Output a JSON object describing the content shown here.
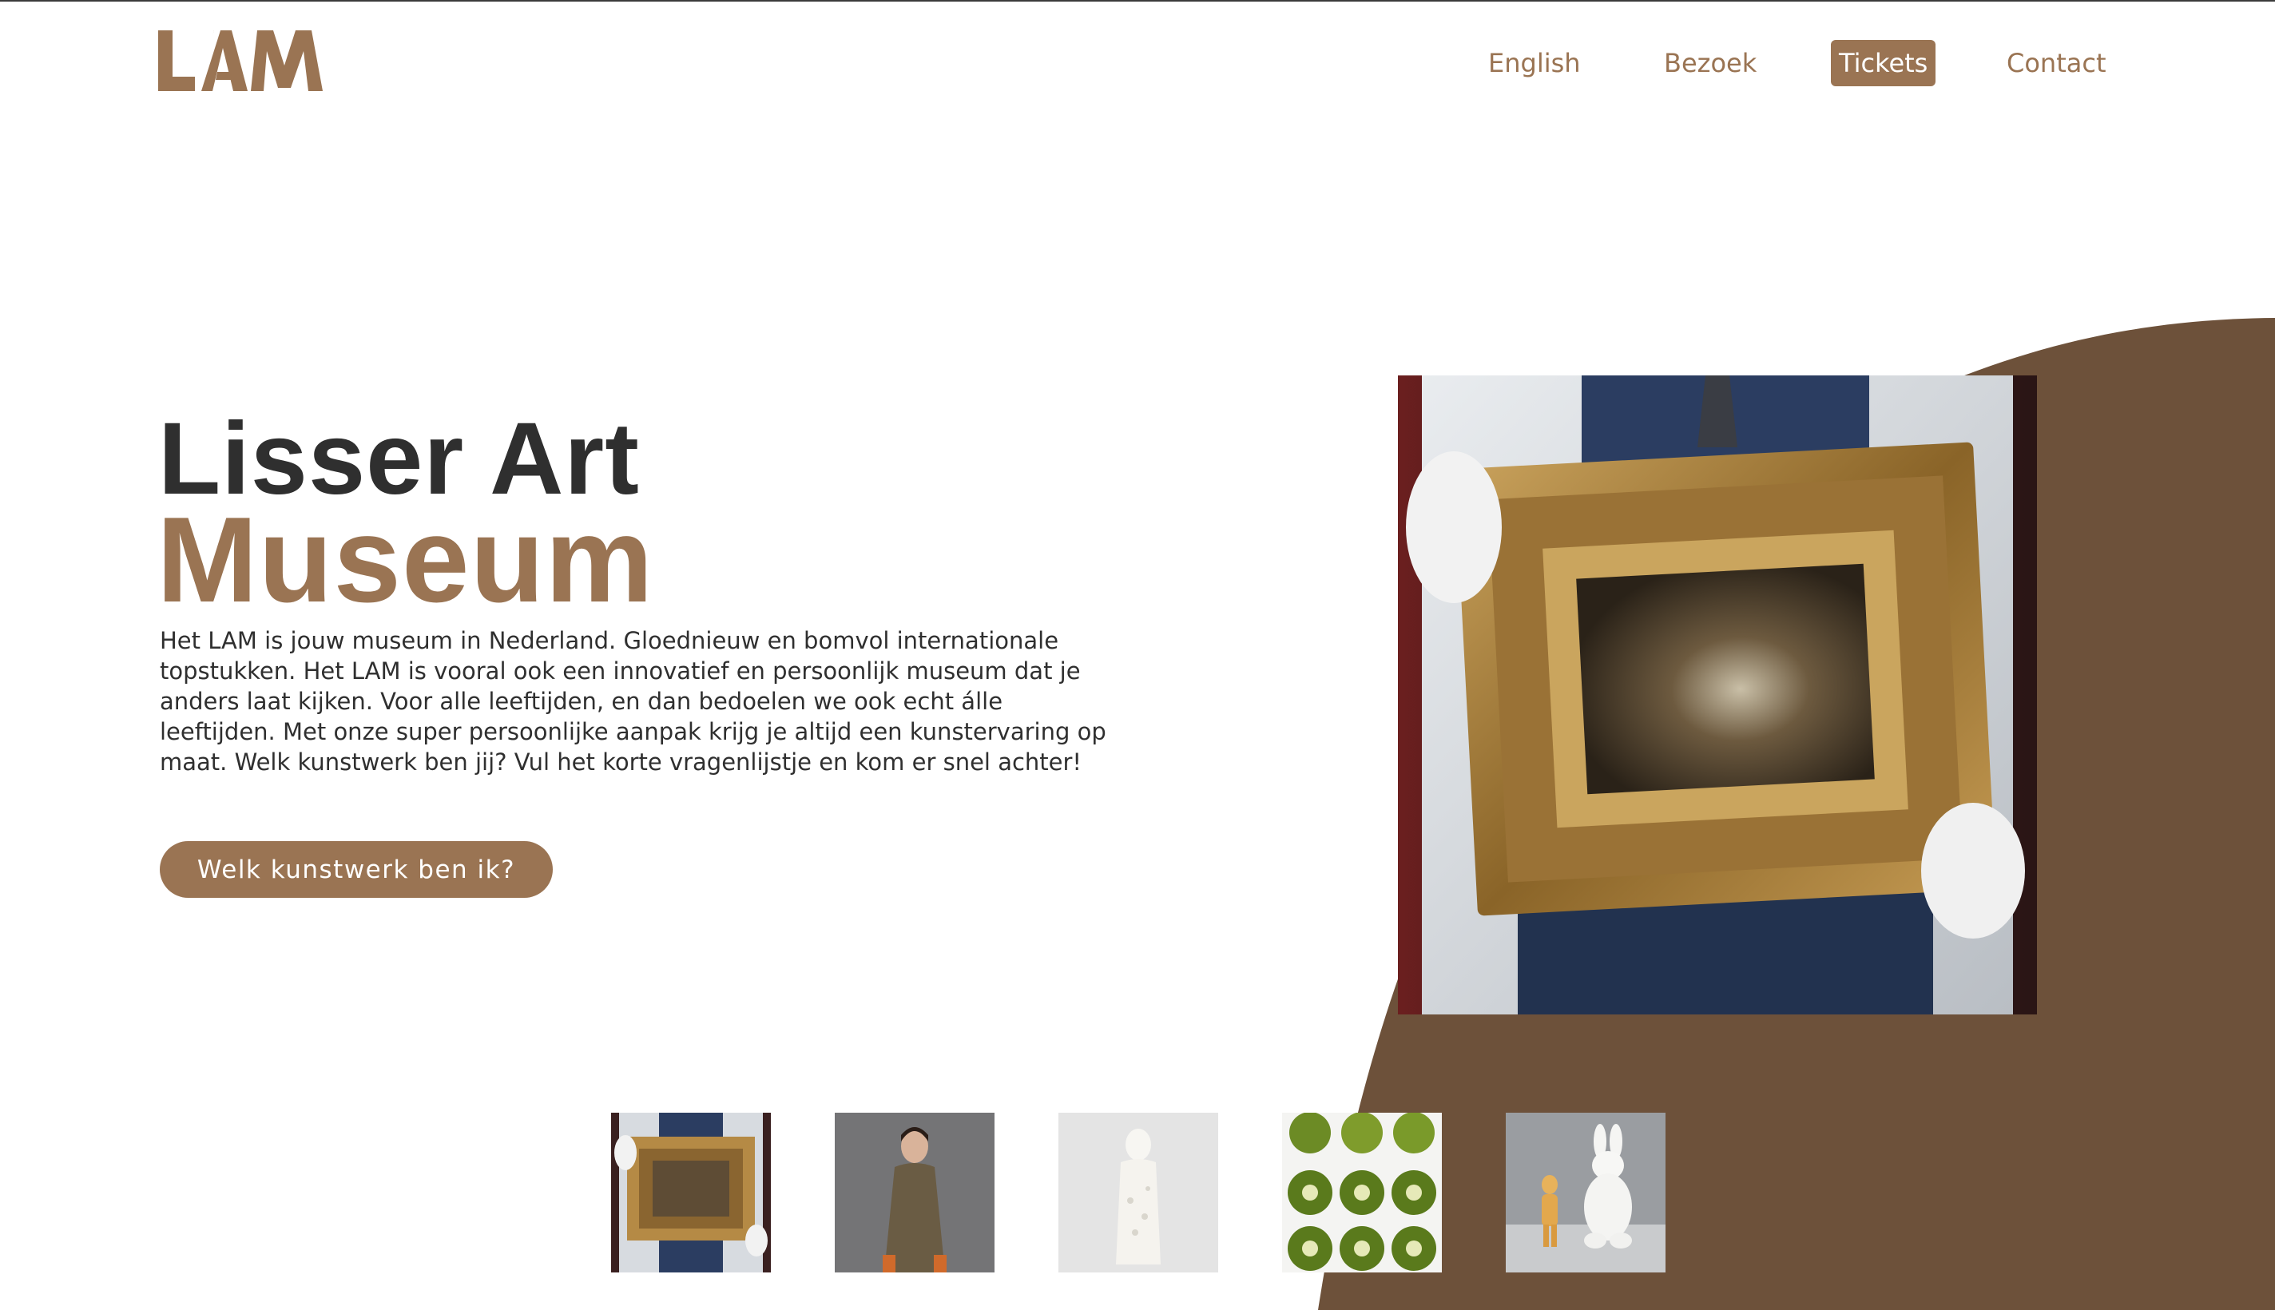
{
  "logo": {
    "text": "LAM"
  },
  "nav": {
    "items": [
      {
        "label": "English"
      },
      {
        "label": "Bezoek"
      },
      {
        "label": "Tickets"
      },
      {
        "label": "Contact"
      }
    ],
    "active": "Tickets"
  },
  "hero": {
    "title_line1": "Lisser Art",
    "title_line2": "Museum",
    "description": "Het LAM is jouw museum in Nederland. Gloednieuw en bomvol internationale topstukken. Het LAM is vooral ook een innovatief en persoonlijk museum dat je anders laat kijken. Voor alle leeftijden, en dan bedoelen we ook echt álle leeftijden. Met onze super persoonlijke aanpak krijg je altijd een kunstervaring op maat. Welk kunstwerk ben jij? Vul het korte vragenlijstje en kom er snel achter!",
    "cta_label": "Welk kunstwerk ben ik?"
  },
  "featured_image": {
    "subject": "framed-painting-held-by-gloved-hands"
  },
  "thumbnails": [
    {
      "subject": "framed-painting"
    },
    {
      "subject": "woman-in-coat"
    },
    {
      "subject": "white-sculpture"
    },
    {
      "subject": "kiwi-slices"
    },
    {
      "subject": "figurines"
    }
  ],
  "colors": {
    "brand": "#9a7453",
    "blob": "#6d513a",
    "text": "#2f2f2f",
    "background": "#ffffff"
  }
}
